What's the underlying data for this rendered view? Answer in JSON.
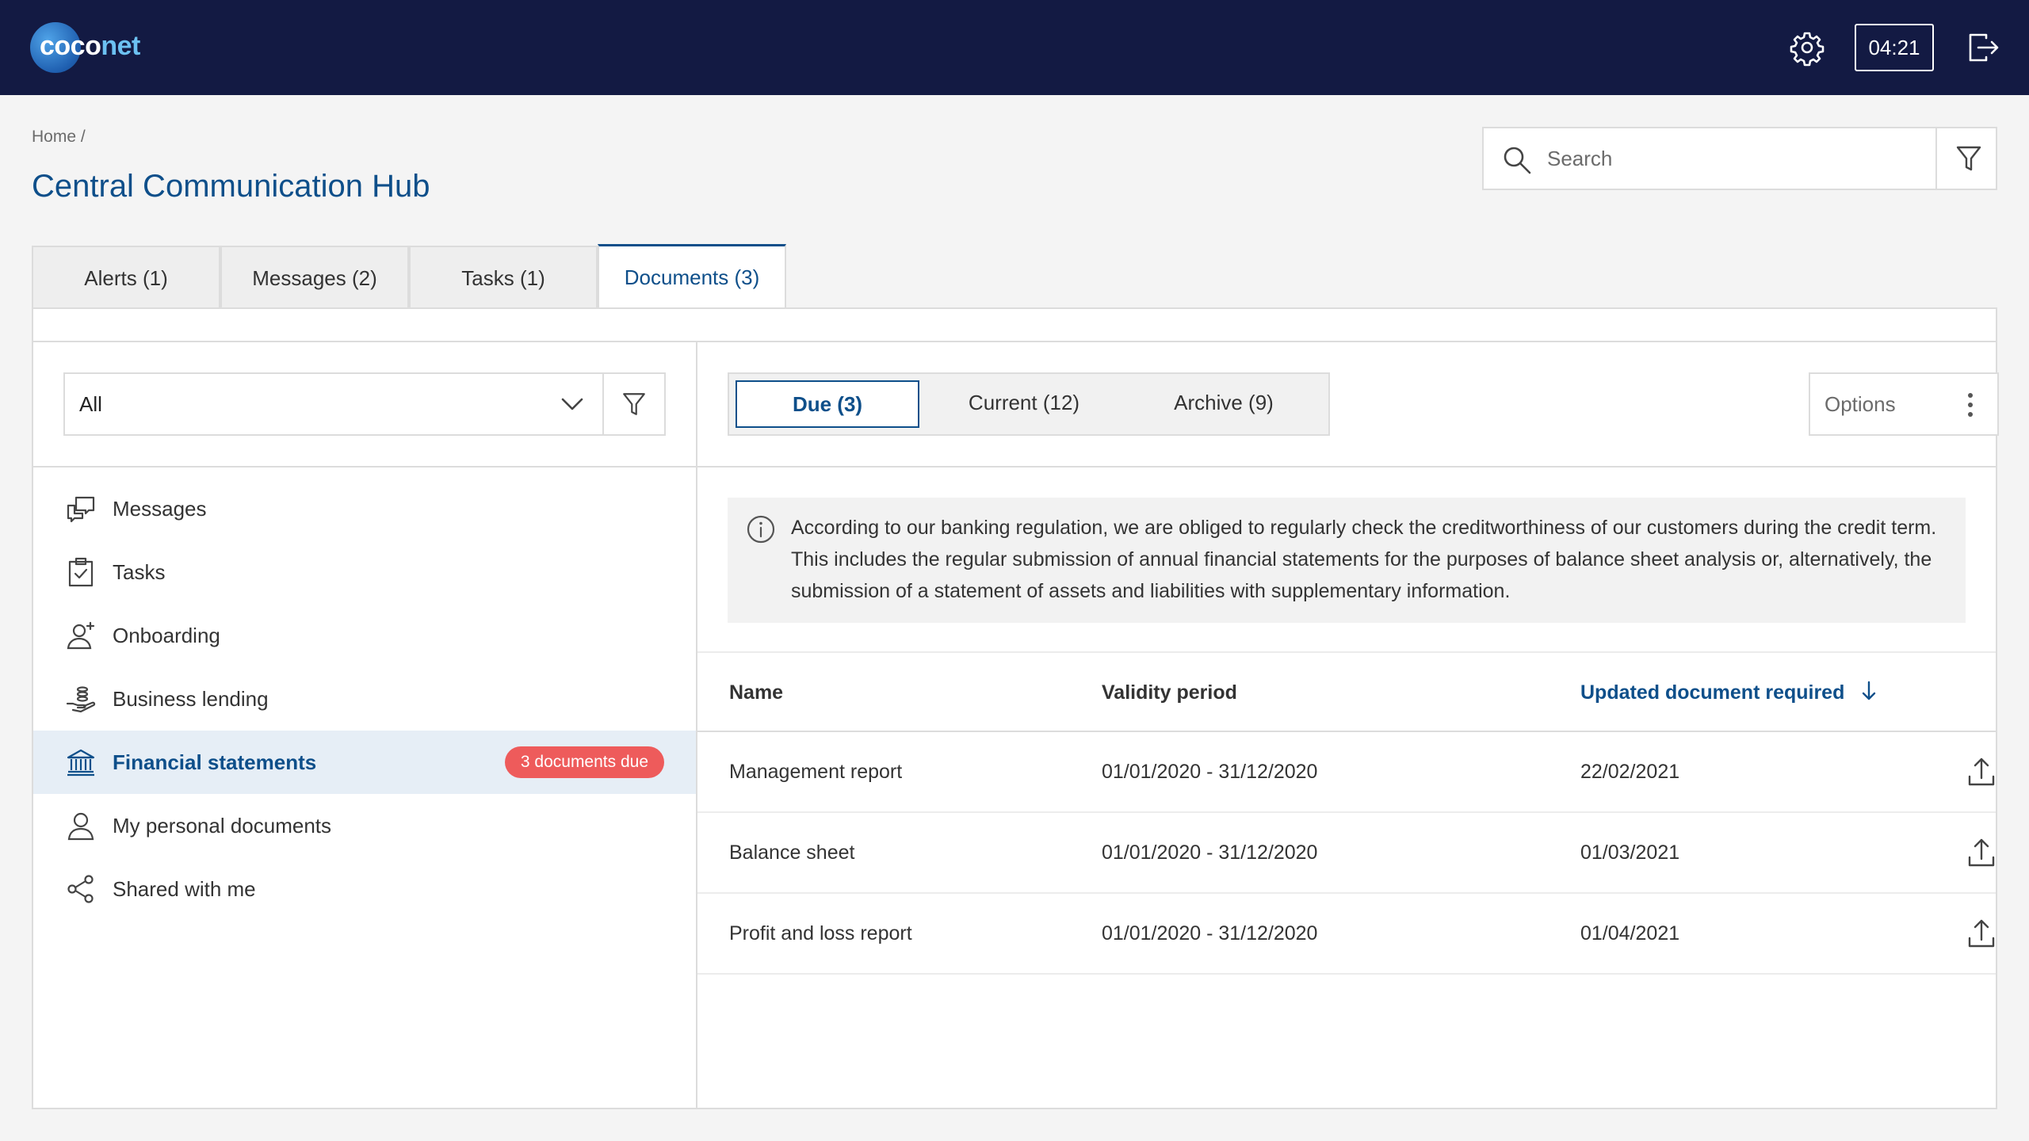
{
  "app": {
    "logo": {
      "part1": "coco",
      "part2": "net"
    },
    "session_timer": "04:21"
  },
  "header": {
    "breadcrumb": "Home /",
    "title": "Central Communication Hub",
    "search_placeholder": "Search"
  },
  "tabs": [
    {
      "label": "Alerts (1)"
    },
    {
      "label": "Messages (2)"
    },
    {
      "label": "Tasks (1)"
    },
    {
      "label": "Documents (3)",
      "active": true
    }
  ],
  "sidebar": {
    "filter_value": "All",
    "items": [
      {
        "label": "Messages",
        "icon": "chat-bubbles-icon"
      },
      {
        "label": "Tasks",
        "icon": "clipboard-check-icon"
      },
      {
        "label": "Onboarding",
        "icon": "person-add-icon"
      },
      {
        "label": "Business lending",
        "icon": "hand-coins-icon"
      },
      {
        "label": "Financial statements",
        "icon": "bank-icon",
        "active": true,
        "badge": "3 documents due"
      },
      {
        "label": "My personal documents",
        "icon": "person-icon"
      },
      {
        "label": "Shared with me",
        "icon": "share-icon"
      }
    ]
  },
  "segments": [
    {
      "label": "Due (3)",
      "active": true
    },
    {
      "label": "Current (12)"
    },
    {
      "label": "Archive (9)"
    }
  ],
  "options_label": "Options",
  "info_text": "According to our banking regulation, we are obliged to regularly check the creditworthiness of our customers during the credit term. This includes the regular submission of annual financial statements for the purposes of balance sheet analysis or, alternatively, the submission of a statement of assets and liabilities with supplementary information.",
  "table": {
    "columns": [
      "Name",
      "Validity period",
      "Updated document required"
    ],
    "sorted_column": "Updated document required",
    "rows": [
      {
        "name": "Management report",
        "validity": "01/01/2020 - 31/12/2020",
        "required": "22/02/2021"
      },
      {
        "name": "Balance sheet",
        "validity": "01/01/2020 - 31/12/2020",
        "required": "01/03/2021"
      },
      {
        "name": "Profit and loss report",
        "validity": "01/01/2020 - 31/12/2020",
        "required": "01/04/2021"
      }
    ]
  },
  "colors": {
    "topbar": "#131a43",
    "accent": "#0e4f8a",
    "badge": "#ee5b5b",
    "active_row": "#e6eef6"
  }
}
